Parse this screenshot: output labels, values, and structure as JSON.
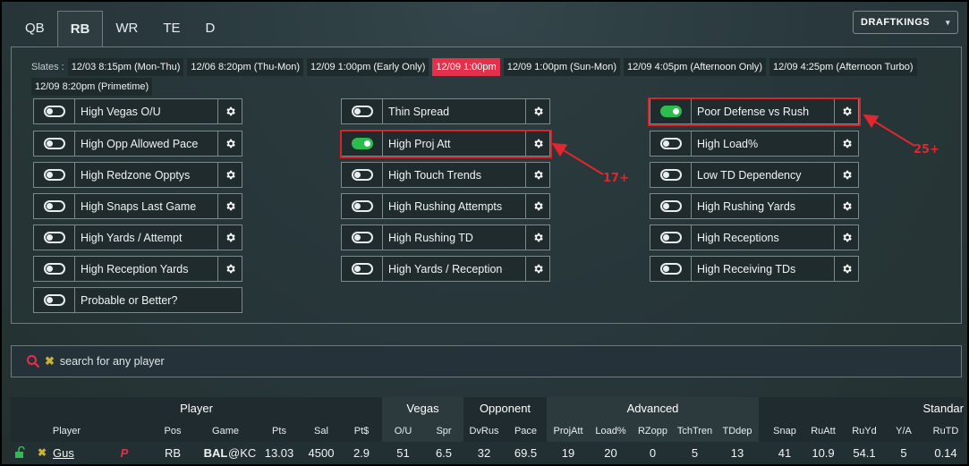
{
  "position_tabs": [
    {
      "label": "QB",
      "active": false
    },
    {
      "label": "RB",
      "active": true
    },
    {
      "label": "WR",
      "active": false
    },
    {
      "label": "TE",
      "active": false
    },
    {
      "label": "D",
      "active": false
    }
  ],
  "site_selector": {
    "label": "DRAFTKINGS",
    "caret": "▾"
  },
  "slates": {
    "label": "Slates :",
    "items": [
      {
        "label": "12/03 8:15pm (Mon-Thu)",
        "active": false
      },
      {
        "label": "12/06 8:20pm (Thu-Mon)",
        "active": false
      },
      {
        "label": "12/09 1:00pm (Early Only)",
        "active": false
      },
      {
        "label": "12/09 1:00pm",
        "active": true
      },
      {
        "label": "12/09 1:00pm (Sun-Mon)",
        "active": false
      },
      {
        "label": "12/09 4:05pm (Afternoon Only)",
        "active": false
      },
      {
        "label": "12/09 4:25pm (Afternoon Turbo)",
        "active": false
      },
      {
        "label": "12/09 8:20pm (Primetime)",
        "active": false
      }
    ]
  },
  "filters": {
    "col1": [
      {
        "label": "High Vegas O/U",
        "on": false
      },
      {
        "label": "High Opp Allowed Pace",
        "on": false
      },
      {
        "label": "High Redzone Opptys",
        "on": false
      },
      {
        "label": "High Snaps Last Game",
        "on": false
      },
      {
        "label": "High Yards / Attempt",
        "on": false
      },
      {
        "label": "High Reception Yards",
        "on": false
      },
      {
        "label": "Probable or Better?",
        "on": false
      }
    ],
    "col2": [
      {
        "label": "Thin Spread",
        "on": false
      },
      {
        "label": "High Proj Att",
        "on": true
      },
      {
        "label": "High Touch Trends",
        "on": false
      },
      {
        "label": "High Rushing Attempts",
        "on": false
      },
      {
        "label": "High Rushing TD",
        "on": false
      },
      {
        "label": "High Yards / Reception",
        "on": false
      }
    ],
    "col3": [
      {
        "label": "Poor Defense vs Rush",
        "on": true
      },
      {
        "label": "High Load%",
        "on": false
      },
      {
        "label": "Low TD Dependency",
        "on": false
      },
      {
        "label": "High Rushing Yards",
        "on": false
      },
      {
        "label": "High Receptions",
        "on": false
      },
      {
        "label": "High Receiving TDs",
        "on": false
      }
    ]
  },
  "annotations": {
    "proj_att": "17+",
    "defense": "25+"
  },
  "colors": {
    "accent_red": "#e5304b",
    "toggle_on": "#2dbd4f",
    "annotation": "#d9222a"
  },
  "search": {
    "placeholder": "search for any player",
    "icon": "search-icon"
  },
  "table": {
    "groups": [
      "Player",
      "Vegas",
      "Opponent",
      "Advanced",
      "Standar"
    ],
    "headers": [
      "Player",
      "Pos",
      "Game",
      "Pts",
      "Sal",
      "Pt$",
      "O/U",
      "Spr",
      "DvRus",
      "Pace",
      "ProjAtt",
      "Load%",
      "RZopp",
      "TchTren",
      "TDdep",
      "Snap",
      "RuAtt",
      "RuYd",
      "Y/A",
      "RuTD"
    ],
    "rows": [
      {
        "player": "Gus Edwards",
        "status": "P",
        "pos": "RB",
        "team": "BAL",
        "opp": "@KC",
        "pts": "13.03",
        "sal": "4500",
        "pts_per": "2.9",
        "ou": "51",
        "spr": "6.5",
        "dvrus": "32",
        "pace": "69.5",
        "projatt": "19",
        "load": "20",
        "rzopp": "0",
        "tchtren": "5",
        "tddep": "13",
        "snap": "41",
        "ruatt": "10.9",
        "ruyd": "54.1",
        "ya": "5",
        "rutd": "0.14"
      }
    ]
  }
}
